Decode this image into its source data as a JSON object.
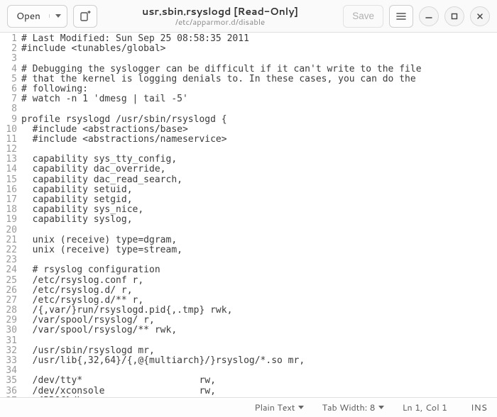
{
  "header": {
    "open_label": "Open",
    "title": "usr.sbin.rsyslogd [Read-Only]",
    "subtitle": "/etc/apparmor.d/disable",
    "save_label": "Save"
  },
  "code_lines": [
    "# Last Modified: Sun Sep 25 08:58:35 2011",
    "#include <tunables/global>",
    "",
    "# Debugging the syslogger can be difficult if it can't write to the file",
    "# that the kernel is logging denials to. In these cases, you can do the",
    "# following:",
    "# watch -n 1 'dmesg | tail -5'",
    "",
    "profile rsyslogd /usr/sbin/rsyslogd {",
    "  #include <abstractions/base>",
    "  #include <abstractions/nameservice>",
    "",
    "  capability sys_tty_config,",
    "  capability dac_override,",
    "  capability dac_read_search,",
    "  capability setuid,",
    "  capability setgid,",
    "  capability sys_nice,",
    "  capability syslog,",
    "",
    "  unix (receive) type=dgram,",
    "  unix (receive) type=stream,",
    "",
    "  # rsyslog configuration",
    "  /etc/rsyslog.conf r,",
    "  /etc/rsyslog.d/ r,",
    "  /etc/rsyslog.d/** r,",
    "  /{,var/}run/rsyslogd.pid{,.tmp} rwk,",
    "  /var/spool/rsyslog/ r,",
    "  /var/spool/rsyslog/** rwk,",
    "",
    "  /usr/sbin/rsyslogd mr,",
    "  /usr/lib{,32,64}/{,@{multiarch}/}rsyslog/*.so mr,",
    "",
    "  /dev/tty*                     rw,",
    "  /dev/xconsole                 rw,",
    "  @{PROC}/kmsg                  r,"
  ],
  "statusbar": {
    "syntax": "Plain Text",
    "tabwidth": "Tab Width: 8",
    "cursor": "Ln 1, Col 1",
    "mode": "INS"
  }
}
